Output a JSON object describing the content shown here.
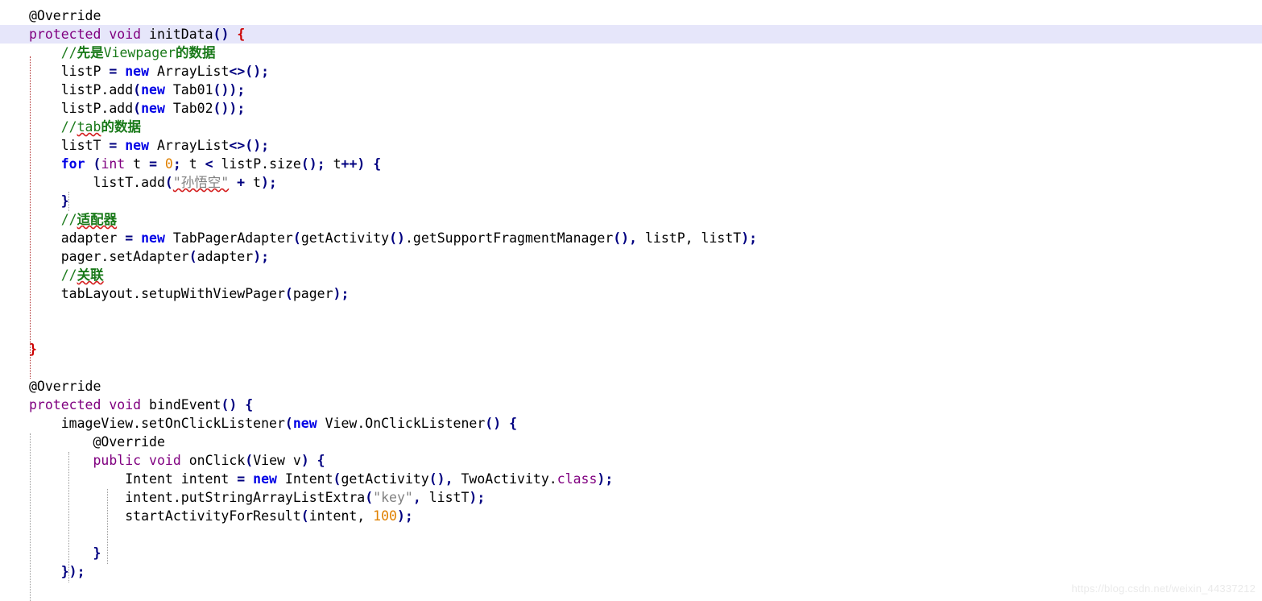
{
  "editor": {
    "language": "java",
    "theme": {
      "background": "#ffffff",
      "foreground": "#000000",
      "current_line_highlight": "#e6e6fa",
      "keyword": "#800080",
      "keyword_bold": "#0000e6",
      "punctuation": "#000080",
      "brace_red": "#cc0000",
      "number": "#e08000",
      "string": "#808080",
      "comment": "#1a7a1a",
      "indent_guide": "#9a9a9a",
      "indent_guide_active": "#b03030",
      "spellcheck_underline": "#d42020",
      "watermark": "#eaeaea"
    },
    "highlighted_line_number": 2
  },
  "code": {
    "l1": {
      "anno": "@Override"
    },
    "l2": {
      "kw1": "protected",
      "kw2": "void",
      "name": "initData",
      "parens": "()",
      "brace": "{"
    },
    "l3": {
      "slashes": "//",
      "cjk1": "先是",
      "plain": "Viewpager",
      "cjk2": "的数据"
    },
    "l4": {
      "var": "listP ",
      "eq": "=",
      "kw": "new",
      "type": " ArrayList",
      "diamond": "<>();"
    },
    "l5": {
      "call": "listP.add",
      "open": "(",
      "kw": "new",
      "type": " Tab01",
      "close": "());"
    },
    "l6": {
      "call": "listP.add",
      "open": "(",
      "kw": "new",
      "type": " Tab02",
      "close": "());"
    },
    "l7": {
      "slashes": "//",
      "sq": "tab",
      "cjk": "的数据"
    },
    "l8": {
      "var": "listT ",
      "eq": "=",
      "kw": "new",
      "type": " ArrayList",
      "diamond": "<>();"
    },
    "l9": {
      "kw": "for",
      "open": " (",
      "type": "int",
      "var": " t ",
      "eq": "=",
      "num": " 0",
      "semi": ";",
      "cond": " t ",
      "lt": "<",
      "expr": " listP.size",
      "parens": "();",
      "inc": " t",
      "plusplus": "++",
      "closep": ")",
      "brace": " {"
    },
    "l10": {
      "call": "listT.add",
      "open": "(",
      "str": "\"孙悟空\"",
      "plus": " +",
      "arg": " t",
      "close": ");"
    },
    "l11": {
      "brace": "}"
    },
    "l12": {
      "slashes": "//",
      "cjk": "适配器"
    },
    "l13": {
      "var": "adapter ",
      "eq": "=",
      "kw": "new",
      "type": " TabPagerAdapter",
      "open": "(",
      "expr1": "getActivity",
      "p1": "()",
      "expr2": ".getSupportFragmentManager",
      "p2": "()",
      "comma1": ",",
      "args": " listP, listT",
      "close": ");"
    },
    "l14": {
      "call": "pager.setAdapter",
      "open": "(",
      "arg": "adapter",
      "close": ");"
    },
    "l15": {
      "slashes": "//",
      "cjk": "关联"
    },
    "l16": {
      "call": "tabLayout.setupWithViewPager",
      "open": "(",
      "arg": "pager",
      "close": ");"
    },
    "l17": {
      "blank": ""
    },
    "l18": {
      "blank": ""
    },
    "l19": {
      "brace": "}"
    },
    "l20": {
      "blank": ""
    },
    "l21": {
      "anno": "@Override"
    },
    "l22": {
      "kw1": "protected",
      "kw2": "void",
      "name": "bindEvent",
      "parens": "()",
      "brace": "{"
    },
    "l23": {
      "call": "imageView.setOnClickListener",
      "open": "(",
      "kw": "new",
      "type": " View.OnClickListener",
      "parens": "()",
      "brace": " {"
    },
    "l24": {
      "anno": "@Override"
    },
    "l25": {
      "kw1": "public",
      "kw2": "void",
      "name": "onClick",
      "open": "(",
      "param": "View v",
      "close": ")",
      "brace": " {"
    },
    "l26": {
      "type": "Intent intent ",
      "eq": "=",
      "kw": "new",
      "ctor": " Intent",
      "open": "(",
      "expr": "getActivity",
      "p1": "()",
      "comma": ",",
      "arg2": " TwoActivity",
      "dot": ".",
      "cls": "class",
      "close": ");"
    },
    "l27": {
      "call": "intent.putStringArrayListExtra",
      "open": "(",
      "str": "\"key\"",
      "comma": ",",
      "arg": " listT",
      "close": ");"
    },
    "l28": {
      "call": "startActivityForResult",
      "open": "(",
      "arg": "intent,",
      "num": " 100",
      "close": ");"
    },
    "l29": {
      "blank": ""
    },
    "l30": {
      "brace": "}"
    },
    "l31": {
      "brace": "});"
    }
  },
  "watermark": {
    "text": "https://blog.csdn.net/weixin_44337212"
  }
}
